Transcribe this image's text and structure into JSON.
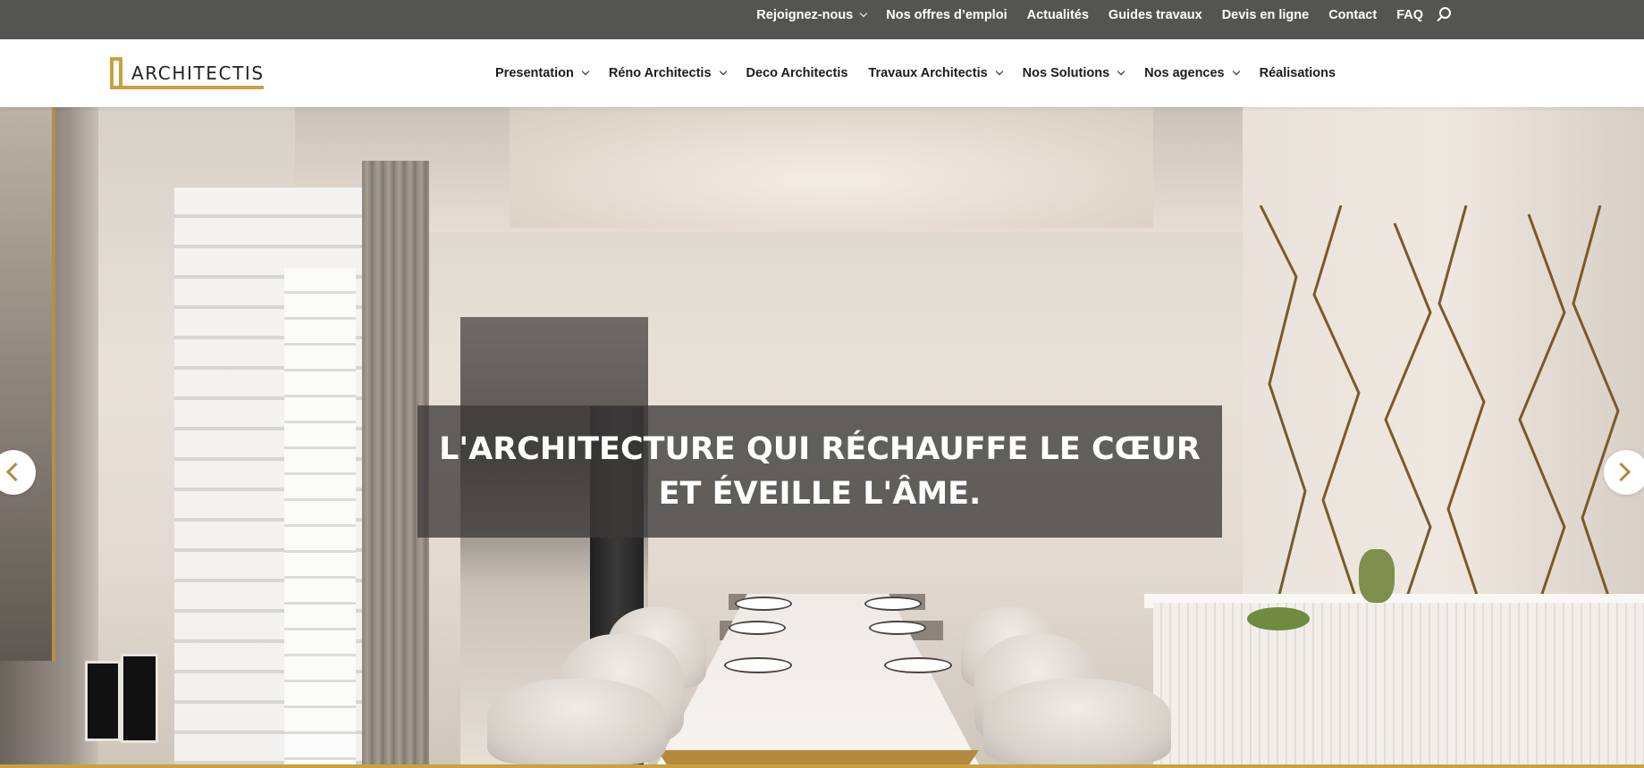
{
  "topbar": {
    "items": [
      {
        "label": "Rejoignez-nous",
        "has_dropdown": true
      },
      {
        "label": "Nos offres d’emploi"
      },
      {
        "label": "Actualités"
      },
      {
        "label": "Guides travaux"
      },
      {
        "label": "Devis en ligne"
      },
      {
        "label": "Contact"
      },
      {
        "label": "FAQ"
      }
    ],
    "search_icon": "search-icon"
  },
  "header": {
    "logo_text": "ARCHITECTIS",
    "nav": [
      {
        "label": "Presentation",
        "has_dropdown": true
      },
      {
        "label": "Réno Architectis",
        "has_dropdown": true
      },
      {
        "label": "Deco Architectis",
        "has_dropdown": false
      },
      {
        "label": "Travaux Architectis",
        "has_dropdown": true
      },
      {
        "label": "Nos Solutions",
        "has_dropdown": true
      },
      {
        "label": "Nos agences",
        "has_dropdown": true
      },
      {
        "label": "Réalisations",
        "has_dropdown": false
      }
    ]
  },
  "hero": {
    "title": "L'ARCHITECTURE QUI RÉCHAUFFE LE CŒUR ET ÉVEILLE L'ÂME.",
    "prev_icon": "chevron-left-icon",
    "next_icon": "chevron-right-icon"
  },
  "colors": {
    "topbar_bg": "#545553",
    "accent_gold": "#c9a13f",
    "banner_bg": "#3c3a38"
  }
}
